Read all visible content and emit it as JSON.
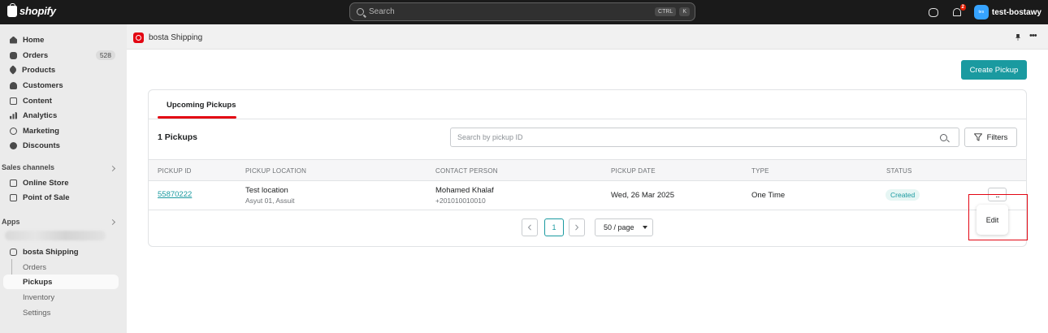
{
  "topbar": {
    "brand": "shopify",
    "search_placeholder": "Search",
    "shortcut_keys": [
      "CTRL",
      "K"
    ],
    "notification_count": "2",
    "avatar_initials": "tes",
    "store_name": "test-bostawy"
  },
  "sidebar": {
    "main_items": [
      {
        "label": "Home",
        "icon": "home-icon"
      },
      {
        "label": "Orders",
        "icon": "orders-icon",
        "count": "528"
      },
      {
        "label": "Products",
        "icon": "tag-icon"
      },
      {
        "label": "Customers",
        "icon": "person-icon"
      },
      {
        "label": "Content",
        "icon": "content-icon"
      },
      {
        "label": "Analytics",
        "icon": "bar-chart-icon"
      },
      {
        "label": "Marketing",
        "icon": "target-icon"
      },
      {
        "label": "Discounts",
        "icon": "discount-icon"
      }
    ],
    "sales_channels_label": "Sales channels",
    "sales_channels": [
      {
        "label": "Online Store",
        "icon": "store-icon"
      },
      {
        "label": "Point of Sale",
        "icon": "pos-icon"
      }
    ],
    "apps_label": "Apps",
    "app_name": "bosta Shipping",
    "app_sub_items": [
      "Orders",
      "Pickups",
      "Inventory",
      "Settings"
    ],
    "active_sub_item": "Pickups"
  },
  "app_header": {
    "title": "bosta Shipping"
  },
  "page": {
    "create_button": "Create Pickup",
    "tab_label": "Upcoming Pickups",
    "count_label": "1 Pickups",
    "search_placeholder": "Search by pickup ID",
    "filters_label": "Filters"
  },
  "table": {
    "columns": [
      "PICKUP ID",
      "PICKUP LOCATION",
      "CONTACT PERSON",
      "PICKUP DATE",
      "TYPE",
      "STATUS"
    ],
    "rows": [
      {
        "pickup_id": "55870222",
        "location_name": "Test location",
        "location_address": "Asyut 01, Assuit",
        "contact_name": "Mohamed Khalaf",
        "contact_phone": "+201010010010",
        "pickup_date": "Wed, 26 Mar 2025",
        "type": "One Time",
        "status": "Created"
      }
    ]
  },
  "pagination": {
    "current_page": "1",
    "page_size": "50 / page"
  },
  "row_menu": {
    "button_label": "...",
    "items": [
      "Edit"
    ]
  },
  "colors": {
    "accent": "#1a9aa0",
    "brand_red": "#e30613",
    "topbar": "#1a1a1a"
  }
}
